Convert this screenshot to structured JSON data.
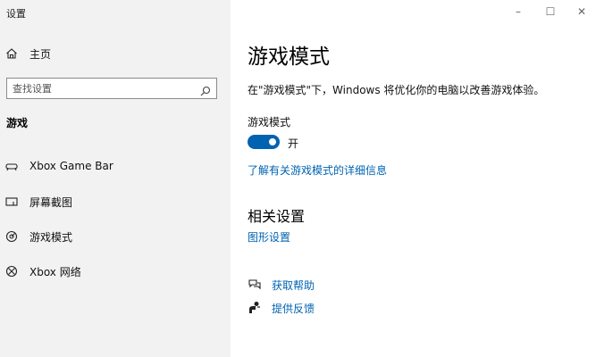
{
  "window": {
    "title": "设置",
    "controls": {
      "minimize": "–",
      "maximize": "☐",
      "close": "✕"
    }
  },
  "sidebar": {
    "home_label": "主页",
    "search_placeholder": "查找设置",
    "section_title": "游戏",
    "items": [
      {
        "label": "Xbox Game Bar",
        "icon": "xbox-game-bar-icon"
      },
      {
        "label": "屏幕截图",
        "icon": "capture-icon"
      },
      {
        "label": "游戏模式",
        "icon": "game-mode-icon"
      },
      {
        "label": "Xbox 网络",
        "icon": "xbox-icon"
      }
    ]
  },
  "main": {
    "title": "游戏模式",
    "description": "在\"游戏模式\"下，Windows 将优化你的电脑以改善游戏体验。",
    "setting_label": "游戏模式",
    "toggle": {
      "on": true,
      "state_label": "开"
    },
    "learn_more_link": "了解有关游戏模式的详细信息",
    "related_title": "相关设置",
    "graphics_link": "图形设置",
    "help_links": [
      {
        "label": "获取帮助",
        "icon": "help-chat-icon"
      },
      {
        "label": "提供反馈",
        "icon": "feedback-icon"
      }
    ]
  },
  "colors": {
    "accent": "#0063b1",
    "sidebar_bg": "#f2f2f2",
    "content_bg": "#ffffff"
  }
}
